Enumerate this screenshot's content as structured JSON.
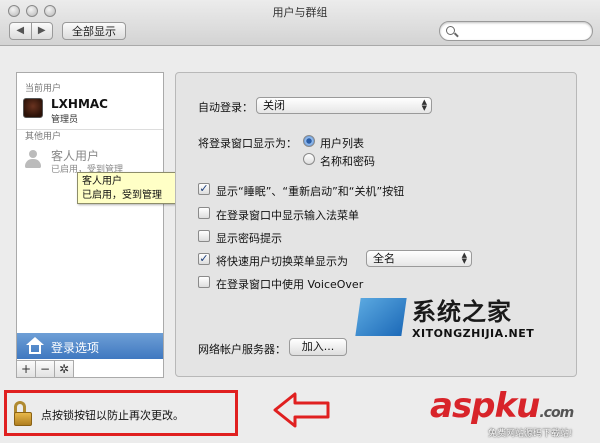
{
  "window": {
    "title": "用户与群组"
  },
  "toolbar": {
    "back": "◀",
    "forward": "▶",
    "show_all": "全部显示",
    "search_placeholder": ""
  },
  "sidebar": {
    "current_header": "当前用户",
    "current_user": {
      "name": "LXHMAC",
      "role": "管理员"
    },
    "other_header": "其他用户",
    "guest_user": {
      "name": "客人用户",
      "status": "已启用，受到管理"
    },
    "login_options": "登录选项",
    "tools": {
      "add": "+",
      "remove": "−",
      "gear": "✲"
    }
  },
  "tooltip": {
    "line1": "客人用户",
    "line2": "已启用，受到管理"
  },
  "panel": {
    "auto_login_label": "自动登录：",
    "auto_login_value": "关闭",
    "display_as_label": "将登录窗口显示为：",
    "radio_list": "用户列表",
    "radio_name_pwd": "名称和密码",
    "chk_sleep": "显示“睡眠”、“重新启动”和“关机”按钮",
    "chk_input_menu": "在登录窗口中显示输入法菜单",
    "chk_pwd_hint": "显示密码提示",
    "chk_fast_switch": "将快速用户切换菜单显示为",
    "fast_switch_value": "全名",
    "chk_voiceover": "在登录窗口中使用 VoiceOver",
    "network_label": "网络帐户服务器：",
    "network_button": "加入..."
  },
  "lock": {
    "text": "点按锁按钮以防止再次更改。"
  },
  "watermarks": {
    "site1_title": "系统之家",
    "site1_url": "XITONGZHIJIA.NET",
    "site2_brand": "aspku",
    "site2_suffix": ".com",
    "site2_sub": "免费网站源码下载站!"
  },
  "colors": {
    "selection": "#3f78c0",
    "annotation_red": "#e02020",
    "brand_red": "#d8242a"
  }
}
